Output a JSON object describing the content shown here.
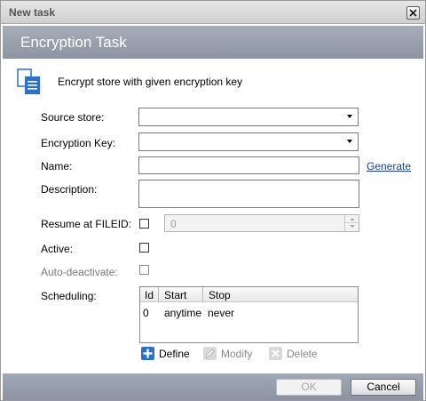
{
  "window": {
    "title": "New task"
  },
  "header": {
    "title": "Encryption Task"
  },
  "intro": {
    "text": "Encrypt store with given encryption key",
    "icon": "document-stack-icon"
  },
  "form": {
    "source_store": {
      "label": "Source store:",
      "value": ""
    },
    "encryption_key": {
      "label": "Encryption Key:",
      "value": ""
    },
    "name": {
      "label": "Name:",
      "value": ""
    },
    "generate_link": "Generate",
    "description": {
      "label": "Description:",
      "value": ""
    },
    "resume_at_fileid": {
      "label": "Resume at FILEID:",
      "checked": false,
      "value": "0"
    },
    "active": {
      "label": "Active:",
      "checked": false
    },
    "auto_deactivate": {
      "label": "Auto-deactivate:",
      "checked": false
    }
  },
  "scheduling": {
    "label": "Scheduling:",
    "columns": [
      "Id",
      "Start",
      "Stop"
    ],
    "rows": [
      {
        "id": "0",
        "start": "anytime",
        "stop": "never"
      }
    ],
    "actions": {
      "define": "Define",
      "modify": "Modify",
      "delete": "Delete"
    }
  },
  "buttons": {
    "ok": "OK",
    "cancel": "Cancel"
  },
  "colors": {
    "header_bg": "#8c93a2",
    "link": "#1a3ea8",
    "define_icon": "#2d6fc9"
  }
}
